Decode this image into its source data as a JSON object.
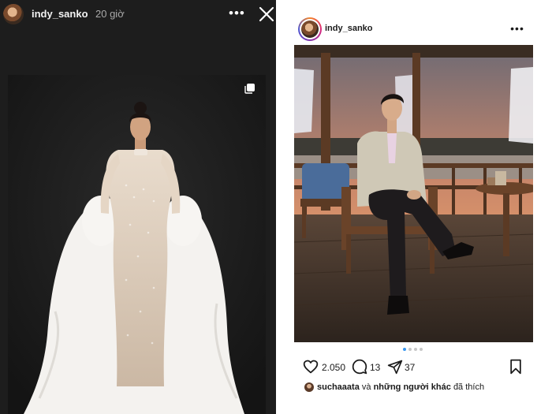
{
  "story": {
    "username": "indy_sanko",
    "time": "20 giờ"
  },
  "post": {
    "username": "indy_sanko",
    "likes_count": "2.050",
    "comments_count": "13",
    "shares_count": "37",
    "liked_by_user": "suchaaata",
    "liked_by_connector": "và",
    "liked_by_others": "những người khác",
    "liked_by_suffix": "đã thích",
    "carousel_dots": 4,
    "carousel_active": 1
  },
  "colors": {
    "story_bg": "#1d1d1d",
    "carousel_active": "#3897f0",
    "ring_gradient": [
      "#f58529",
      "#dd2a7b",
      "#8134af",
      "#515bd4"
    ]
  }
}
